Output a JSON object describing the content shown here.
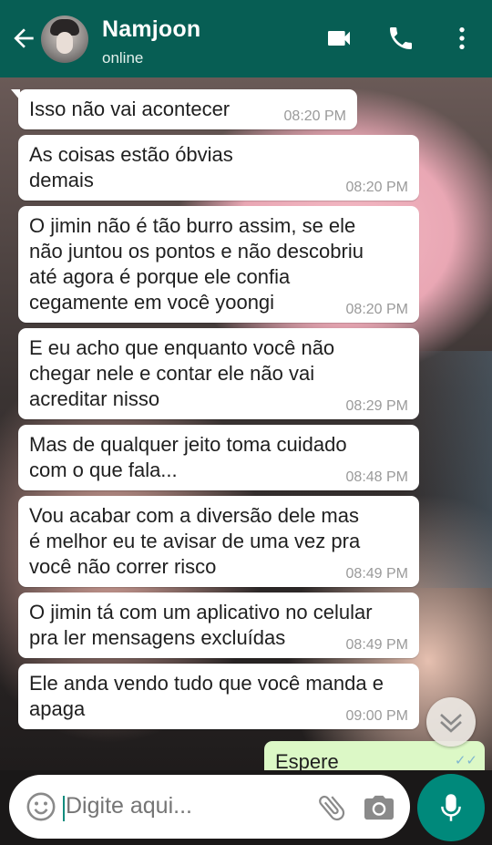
{
  "header": {
    "contact_name": "Namjoon",
    "status": "online",
    "icons": [
      "back-arrow-icon",
      "video-call-icon",
      "phone-call-icon",
      "more-vert-icon"
    ],
    "color": "#075e54"
  },
  "messages": [
    {
      "text": "Isso não vai acontecer",
      "time": "08:20 PM"
    },
    {
      "text": "As coisas estão óbvias\ndemais",
      "time": "08:20 PM"
    },
    {
      "text": "O jimin não é tão burro assim, se ele\nnão juntou os pontos e não descobriu\naté agora é porque ele confia\ncegamente em você yoongi",
      "time": "08:20 PM"
    },
    {
      "text": "E eu acho que enquanto você não\nchegar nele e contar ele não vai\nacreditar nisso",
      "time": "08:29 PM"
    },
    {
      "text": "Mas de qualquer jeito toma cuidado\ncom o que fala...",
      "time": "08:48 PM"
    },
    {
      "text": "Vou acabar com a diversão dele mas\né melhor eu te avisar de uma vez pra\nvocê não correr risco",
      "time": "08:49 PM"
    },
    {
      "text": "O jimin tá com um aplicativo no celular\npra ler mensagens excluídas",
      "time": "08:49 PM"
    },
    {
      "text": "Ele anda vendo tudo que você manda e\napaga",
      "time": "09:00 PM"
    }
  ],
  "sent_partial": {
    "text": "Espere"
  },
  "input": {
    "placeholder": "Digite aqui..."
  },
  "colors": {
    "sent_bubble": "#dcf8c6",
    "accent": "#00897b"
  }
}
